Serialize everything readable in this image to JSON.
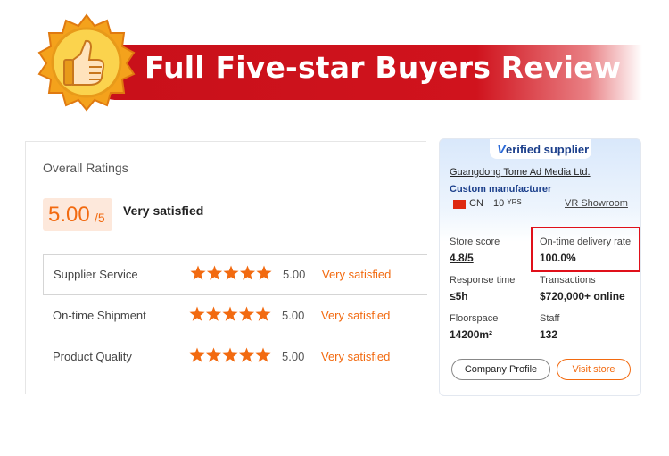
{
  "banner": {
    "title": "Full Five-star Buyers Review"
  },
  "ratings": {
    "heading": "Overall Ratings",
    "overall_score": "5.00",
    "overall_denominator": "/5",
    "overall_label": "Very satisfied",
    "rows": [
      {
        "label": "Supplier Service",
        "stars": 5,
        "score": "5.00",
        "satisfaction": "Very satisfied"
      },
      {
        "label": "On-time Shipment",
        "stars": 5,
        "score": "5.00",
        "satisfaction": "Very satisfied"
      },
      {
        "label": "Product Quality",
        "stars": 5,
        "score": "5.00",
        "satisfaction": "Very satisfied"
      }
    ]
  },
  "supplier": {
    "verified_v": "V",
    "verified_rest": "erified supplier",
    "company_name": "Guangdong Tome Ad Media Ltd.",
    "company_type": "Custom manufacturer",
    "country": "CN",
    "years_number": "10",
    "years_unit": "YRS",
    "vr_link": "VR Showroom",
    "stats": {
      "store_score_label": "Store score",
      "store_score_value": "4.8/5",
      "delivery_label": "On-time delivery rate",
      "delivery_value": "100.0%",
      "response_label": "Response time",
      "response_value": "≤5h",
      "transactions_label": "Transactions",
      "transactions_value": "$720,000+ online",
      "floorspace_label": "Floorspace",
      "floorspace_value": "14200m²",
      "staff_label": "Staff",
      "staff_value": "132"
    },
    "buttons": {
      "profile": "Company Profile",
      "visit": "Visit store"
    }
  },
  "colors": {
    "brand_red": "#d0131d",
    "accent_orange": "#f26a10",
    "verified_blue": "#1b3f8b",
    "star_orange": "#f26a10"
  },
  "icons": {
    "badge": "thumbs-up-icon",
    "star": "star-icon",
    "flag": "china-flag-icon"
  }
}
